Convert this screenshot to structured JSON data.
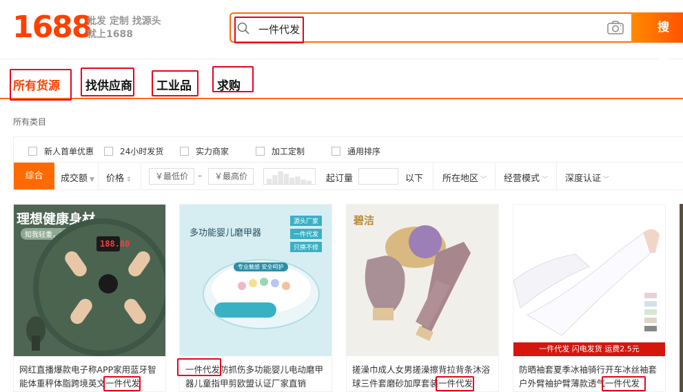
{
  "header": {
    "logo_number": "1688",
    "slogan_line1": "批发 定制 找源头",
    "slogan_line2": "就上1688",
    "search_query": "一件代发",
    "search_button": "搜 索"
  },
  "tabs": [
    {
      "label": "所有货源",
      "active": true
    },
    {
      "label": "找供应商",
      "active": false
    },
    {
      "label": "工业品",
      "active": false
    },
    {
      "label": "求购",
      "active": false
    }
  ],
  "category_label": "所有类目",
  "filter_checks": [
    "新人首单优惠",
    "24小时发货",
    "实力商家",
    "加工定制",
    "通用排序"
  ],
  "sort": {
    "default": "综合",
    "volume": "成交额",
    "price": "价格",
    "min_price_placeholder": "￥最低价",
    "max_price_placeholder": "￥最高价",
    "price_dash": "–",
    "min_order_label": "起订量",
    "below_label": "以下",
    "region": "所在地区",
    "business_mode": "经营模式",
    "certification": "深度认证"
  },
  "products": [
    {
      "title_prefix": "网红直播爆款电子称APP家用蓝牙智能体重秤体脂跨境英文",
      "keyword": "一件代发",
      "img_headline": "理想健康身材",
      "img_tag": "知我轻重，懂我品味",
      "img_display": "188.80"
    },
    {
      "keyword": "一件代发",
      "title_suffix": "防抓伤多功能婴儿电动磨甲器儿童指甲剪欧盟认证厂家直销",
      "img_headline": "多功能婴儿磨甲器",
      "img_tags": [
        "源头厂家",
        "一件代发",
        "只换不修"
      ],
      "img_badge": "专业触感 安全呵护"
    },
    {
      "title_prefix": "搓澡巾成人女男搓澡擦背拉背条沐浴球三件套磨砂加厚套装",
      "keyword": "一件代发",
      "img_brand": "碧洁"
    },
    {
      "title_prefix": "防晒袖套夏季冰袖骑行开车冰丝袖套户外臂袖护臂薄款透气",
      "keyword": "一件代发",
      "img_banner": "一件代发 闪电发货 运费2.5元"
    }
  ],
  "colors": {
    "brand": "#ff6a00",
    "logo": "#ff4000",
    "highlight": "#e8001c"
  }
}
